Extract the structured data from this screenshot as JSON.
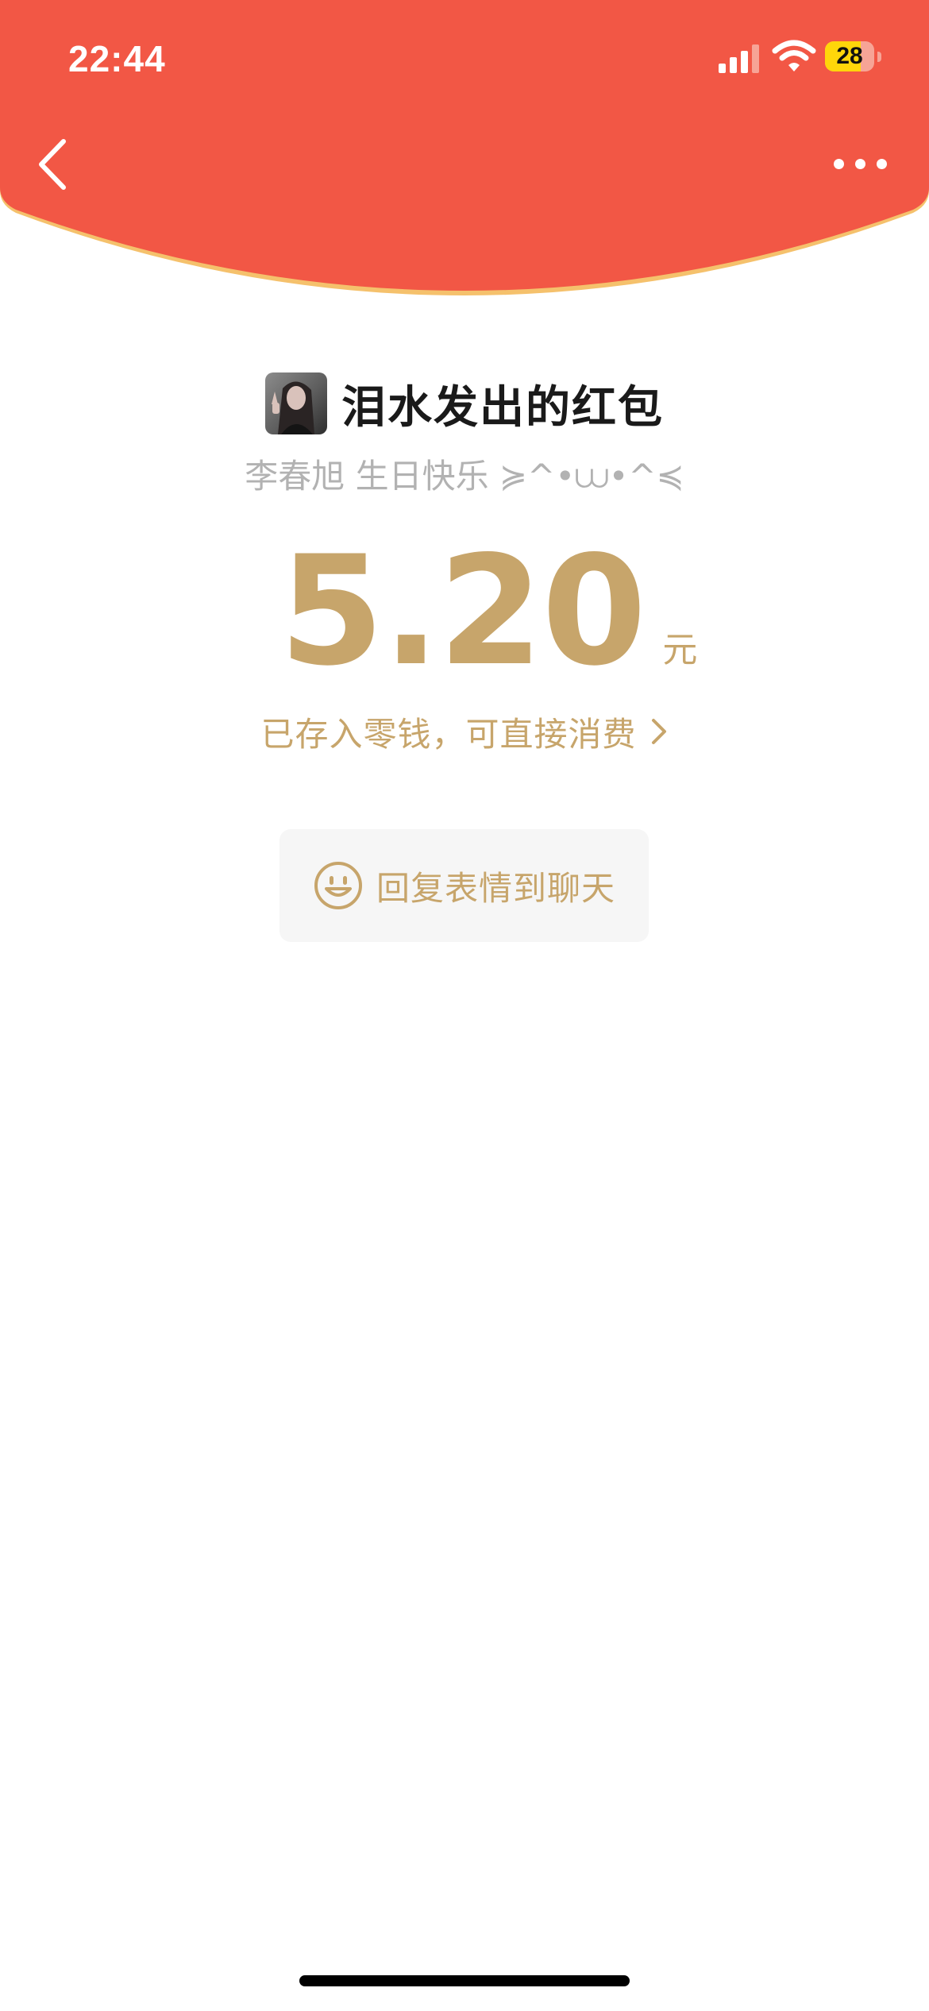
{
  "status_bar": {
    "time": "22:44",
    "battery_level": "28",
    "battery_fraction": 0.28,
    "signal_bars_active": 3,
    "signal_bars_total": 4
  },
  "nav": {
    "back_icon": "chevron-left-icon",
    "more_icon": "ellipsis-icon"
  },
  "red_packet": {
    "sender_title": "泪水发出的红包",
    "blessing": "李春旭 生日快乐 ≽^•⩊•^≼",
    "amount": "5.20",
    "currency": "元",
    "wallet_link": "已存入零钱，可直接消费"
  },
  "reply": {
    "label": "回复表情到聊天",
    "icon": "smile-icon"
  },
  "colors": {
    "header_red": "#F25745",
    "header_edge": "#F5C16C",
    "gold": "#C7A56B",
    "blessing_gray": "#B2B2B2",
    "title_black": "#1A1A1A",
    "reply_bg": "#F6F6F6"
  }
}
